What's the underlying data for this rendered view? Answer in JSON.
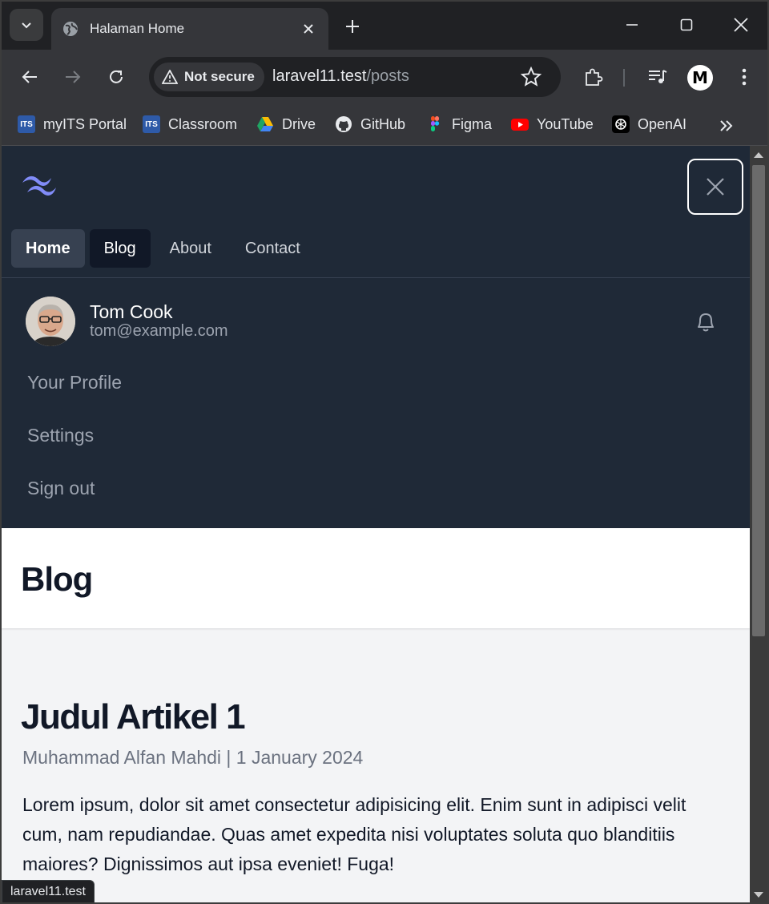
{
  "browser": {
    "tab_title": "Halaman Home",
    "security_label": "Not secure",
    "url_host": "laravel11.test",
    "url_path": "/posts",
    "profile_initial": "M",
    "status_url": "laravel11.test"
  },
  "bookmarks": [
    {
      "label": "myITS Portal",
      "icon": "its-icon"
    },
    {
      "label": "Classroom",
      "icon": "its-icon"
    },
    {
      "label": "Drive",
      "icon": "drive-icon"
    },
    {
      "label": "GitHub",
      "icon": "github-icon"
    },
    {
      "label": "Figma",
      "icon": "figma-icon"
    },
    {
      "label": "YouTube",
      "icon": "youtube-icon"
    },
    {
      "label": "OpenAI",
      "icon": "openai-icon"
    }
  ],
  "nav": {
    "links": [
      "Home",
      "Blog",
      "About",
      "Contact"
    ],
    "active": "Blog"
  },
  "user": {
    "name": "Tom Cook",
    "email": "tom@example.com",
    "menu": [
      "Your Profile",
      "Settings",
      "Sign out"
    ]
  },
  "header": {
    "title": "Blog"
  },
  "article": {
    "title": "Judul Artikel 1",
    "author": "Muhammad Alfan Mahdi",
    "date": "1 January 2024",
    "body": "Lorem ipsum, dolor sit amet consectetur adipisicing elit. Enim sunt in adipisci velit cum, nam repudiandae. Quas amet expedita nisi voluptates soluta quo blanditiis maiores? Dignissimos aut ipsa eveniet! Fuga!"
  },
  "colors": {
    "nav_bg": "#1f2937",
    "logo_accent": "#818cf8",
    "page_bg": "#f3f4f6"
  }
}
